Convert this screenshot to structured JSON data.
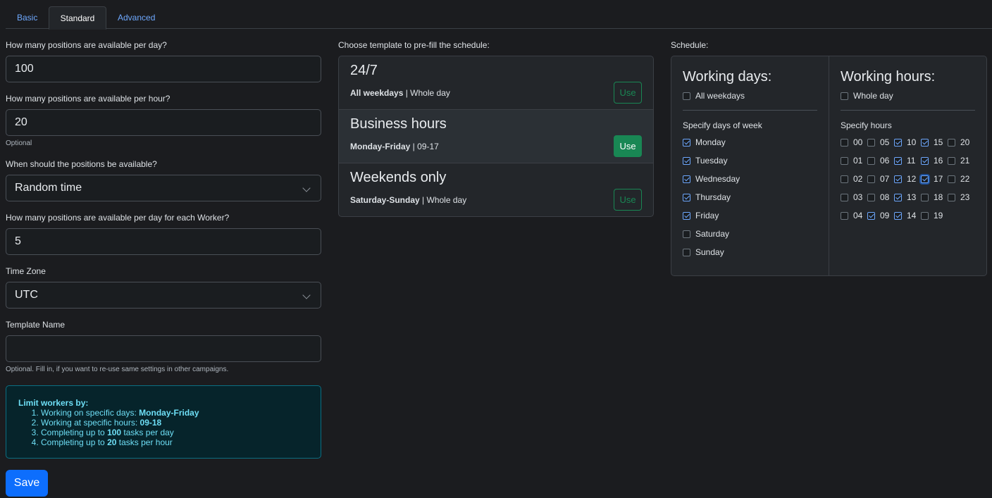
{
  "tabs": [
    {
      "label": "Basic",
      "active": false
    },
    {
      "label": "Standard",
      "active": true
    },
    {
      "label": "Advanced",
      "active": false
    }
  ],
  "form": {
    "per_day_label": "How many positions are available per day?",
    "per_day_value": "100",
    "per_hour_label": "How many positions are available per hour?",
    "per_hour_value": "20",
    "per_hour_hint": "Optional",
    "when_label": "When should the positions be available?",
    "when_value": "Random time",
    "per_worker_label": "How many positions are available per day for each Worker?",
    "per_worker_value": "5",
    "timezone_label": "Time Zone",
    "timezone_value": "UTC",
    "template_name_label": "Template Name",
    "template_name_value": "",
    "template_name_hint": "Optional. Fill in, if you want to re-use same settings in other campaigns."
  },
  "info": {
    "title": "Limit workers by:",
    "items": [
      {
        "text": "Working on specific days: ",
        "value": "Monday-Friday"
      },
      {
        "text": "Working at specific hours: ",
        "value": "09-18"
      },
      {
        "pre": "Completing up to ",
        "value": "100",
        "post": " tasks per day"
      },
      {
        "pre": "Completing up to ",
        "value": "20",
        "post": " tasks per hour"
      }
    ]
  },
  "save_label": "Save",
  "templates": {
    "label": "Choose template to pre-fill the schedule:",
    "items": [
      {
        "name": "24/7",
        "days": "All weekdays",
        "sep": " | ",
        "hours": "Whole day",
        "button": "Use",
        "active": false
      },
      {
        "name": "Business hours",
        "days": "Monday-Friday",
        "sep": " | ",
        "hours": "09-17",
        "button": "Use",
        "active": true
      },
      {
        "name": "Weekends only",
        "days": "Saturday-Sunday",
        "sep": " | ",
        "hours": "Whole day",
        "button": "Use",
        "active": false
      }
    ]
  },
  "schedule": {
    "label": "Schedule:",
    "days_title": "Working days:",
    "all_weekdays": {
      "label": "All weekdays",
      "checked": false
    },
    "days_sub": "Specify days of week",
    "days": [
      {
        "label": "Monday",
        "checked": true
      },
      {
        "label": "Tuesday",
        "checked": true
      },
      {
        "label": "Wednesday",
        "checked": true
      },
      {
        "label": "Thursday",
        "checked": true
      },
      {
        "label": "Friday",
        "checked": true
      },
      {
        "label": "Saturday",
        "checked": false
      },
      {
        "label": "Sunday",
        "checked": false
      }
    ],
    "hours_title": "Working hours:",
    "whole_day": {
      "label": "Whole day",
      "checked": false
    },
    "hours_sub": "Specify hours",
    "hours": [
      {
        "label": "00",
        "checked": false
      },
      {
        "label": "01",
        "checked": false
      },
      {
        "label": "02",
        "checked": false
      },
      {
        "label": "03",
        "checked": false
      },
      {
        "label": "04",
        "checked": false
      },
      {
        "label": "05",
        "checked": false
      },
      {
        "label": "06",
        "checked": false
      },
      {
        "label": "07",
        "checked": false
      },
      {
        "label": "08",
        "checked": false
      },
      {
        "label": "09",
        "checked": true
      },
      {
        "label": "10",
        "checked": true
      },
      {
        "label": "11",
        "checked": true
      },
      {
        "label": "12",
        "checked": true
      },
      {
        "label": "13",
        "checked": true
      },
      {
        "label": "14",
        "checked": true
      },
      {
        "label": "15",
        "checked": true
      },
      {
        "label": "16",
        "checked": true
      },
      {
        "label": "17",
        "checked": true
      },
      {
        "label": "18",
        "checked": false
      },
      {
        "label": "19",
        "checked": false
      },
      {
        "label": "20",
        "checked": false
      },
      {
        "label": "21",
        "checked": false
      },
      {
        "label": "22",
        "checked": false
      },
      {
        "label": "23",
        "checked": false
      }
    ],
    "focused_hour": "17"
  }
}
